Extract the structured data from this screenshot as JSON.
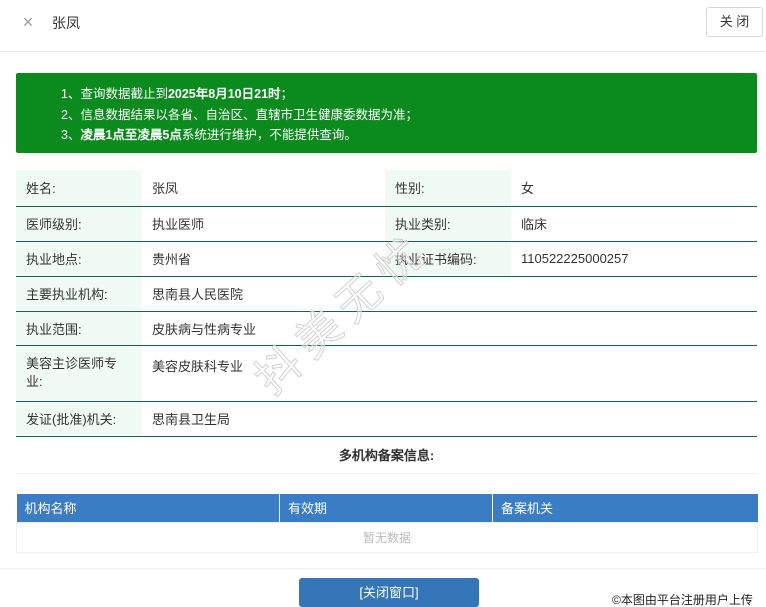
{
  "header": {
    "close_glyph": "×",
    "title": "张凤",
    "close_button": "关 闭"
  },
  "notice": {
    "lines": [
      {
        "pre": "1、查询数据截止到",
        "bold": "2025年8月10日21时",
        "post": "；"
      },
      {
        "pre": "2、信息数据结果以各省、自治区、直辖市卫生健康委数据为准；",
        "bold": "",
        "post": ""
      },
      {
        "pre": "3、",
        "bold": "凌晨1点至凌晨5点",
        "post": "系统进行维护，不能提供查询。"
      }
    ]
  },
  "info": {
    "name_label": "姓名:",
    "name": "张凤",
    "gender_label": "性别:",
    "gender": "女",
    "level_label": "医师级别:",
    "level": "执业医师",
    "category_label": "执业类别:",
    "category": "临床",
    "location_label": "执业地点:",
    "location": "贵州省",
    "cert_label": "执业证书编码:",
    "cert": "110522225000257",
    "institution_label": "主要执业机构:",
    "institution": "思南县人民医院",
    "scope_label": "执业范围:",
    "scope": "皮肤病与性病专业",
    "cosmetic_label": "美容主诊医师专业:",
    "cosmetic": "美容皮肤科专业",
    "authority_label": "发证(批准)机关:",
    "authority": "思南县卫生局"
  },
  "multi_title": "多机构备案信息:",
  "records": {
    "columns": [
      "机构名称",
      "有效期",
      "备案机关"
    ],
    "empty_text": "暂无数据"
  },
  "footer": {
    "close_window": "[关闭窗口]"
  },
  "watermark": "抖美无忧",
  "upload_note": "©本图由平台注册用户上传",
  "colors": {
    "notice_bg": "#0b8a1e",
    "table_header": "#3b7dc4",
    "button": "#3576b8",
    "label_bg": "#f1fbf6"
  }
}
